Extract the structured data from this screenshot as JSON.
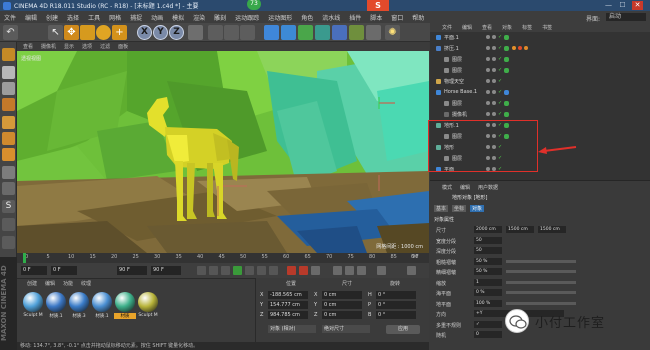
{
  "window": {
    "title": "CINEMA 4D R18.011 Studio (RC - R18) - [未标题 1.c4d *] - 主要",
    "badge": "73",
    "search_logo": "S",
    "layout_label": "界面:",
    "layout_value": "启动"
  },
  "menubar": [
    "文件",
    "编辑",
    "创建",
    "选择",
    "工具",
    "网格",
    "捕捉",
    "动画",
    "模拟",
    "渲染",
    "雕刻",
    "运动跟踪",
    "运动图形",
    "角色",
    "流水线",
    "插件",
    "脚本",
    "窗口",
    "帮助"
  ],
  "toolbar": {
    "axes": [
      "X",
      "Y",
      "Z"
    ]
  },
  "viewport": {
    "menu": [
      "查看",
      "摄像机",
      "显示",
      "选项",
      "过滤",
      "面板"
    ],
    "label": "透视视图",
    "grid_label": "网格间距 : 1000 cm"
  },
  "timeline": {
    "ticks": [
      "0",
      "5",
      "10",
      "15",
      "20",
      "25",
      "30",
      "35",
      "40",
      "45",
      "50",
      "55",
      "60",
      "65",
      "70",
      "75",
      "80",
      "85",
      "90"
    ],
    "frame_end_tick": "0 F",
    "start_field": "0 F",
    "current_field": "0 F",
    "end_field": "90 F",
    "end_field2": "90 F"
  },
  "materials": {
    "menu": [
      "创建",
      "编辑",
      "功能",
      "纹理"
    ],
    "items": [
      {
        "label": "Sculpt M",
        "color": "#4fa0d8"
      },
      {
        "label": "材质.1",
        "color": "#3c78c6"
      },
      {
        "label": "材质.3",
        "color": "#3a7cc8"
      },
      {
        "label": "材质.1",
        "color": "#4a8fd2"
      },
      {
        "label": "材质",
        "color": "#3db08a"
      },
      {
        "label": "Sculpt M",
        "color": "#b8b43a"
      }
    ],
    "brand": "MAXON CINEMA 4D"
  },
  "coordinates": {
    "headers": [
      "位置",
      "尺寸",
      "旋转"
    ],
    "rows": [
      {
        "axis": "X",
        "pos": "-188.565 cm",
        "size": "0 cm",
        "rot_axis": "H",
        "rot": "0 °"
      },
      {
        "axis": "Y",
        "pos": "154.777 cm",
        "size": "0 cm",
        "rot_axis": "P",
        "rot": "0 °"
      },
      {
        "axis": "Z",
        "pos": "984.785 cm",
        "size": "0 cm",
        "rot_axis": "B",
        "rot": "0 °"
      }
    ],
    "mode_obj": "对象 (相对)",
    "mode_size": "绝对尺寸",
    "apply": "应用"
  },
  "objects": {
    "menu": [
      "文件",
      "编辑",
      "查看",
      "对象",
      "标签",
      "书签"
    ],
    "rows": [
      {
        "name": "平面.1",
        "indent": 0
      },
      {
        "name": "挤压.1",
        "indent": 0
      },
      {
        "name": "图层",
        "indent": 1
      },
      {
        "name": "图层",
        "indent": 1
      },
      {
        "name": "物理天空",
        "indent": 0
      },
      {
        "name": "Horse Base.1",
        "indent": 0
      },
      {
        "name": "图层",
        "indent": 1
      },
      {
        "name": "摄像机",
        "indent": 1
      },
      {
        "name": "地形.1",
        "indent": 0
      },
      {
        "name": "图层",
        "indent": 1
      },
      {
        "name": "地形",
        "indent": 0
      },
      {
        "name": "图层",
        "indent": 1
      },
      {
        "name": "平面",
        "indent": 0
      }
    ]
  },
  "attributes": {
    "tabs": [
      "模式",
      "编辑",
      "用户数据"
    ],
    "object_title": "地形对象 [地形]",
    "subtabs": [
      "基本",
      "坐标",
      "对象"
    ],
    "section": "对象属性",
    "rows": [
      {
        "label": "尺寸",
        "v1": "2000 cm",
        "v2": "1500 cm",
        "v3": "1500 cm"
      },
      {
        "label": "宽度分段",
        "v1": "50"
      },
      {
        "label": "深度分段",
        "v1": "50"
      },
      {
        "label": "粗糙褶皱",
        "v1": "50 %"
      },
      {
        "label": "精细褶皱",
        "v1": "50 %"
      },
      {
        "label": "缩放",
        "v1": "1"
      },
      {
        "label": "海平面",
        "v1": "0 %"
      },
      {
        "label": "地平面",
        "v1": "100 %"
      },
      {
        "label": "方向",
        "v1": "+Y"
      },
      {
        "label": "多重不规则",
        "v1": "✓"
      },
      {
        "label": "随机",
        "v1": "0"
      }
    ]
  },
  "watermark": {
    "text": "小付工作室"
  },
  "status": {
    "text": "移动: 134.7°, 3.8°, -0.1°  点击并拖动鼠标移动元素。按住 SHIFT 键量化移动。"
  }
}
